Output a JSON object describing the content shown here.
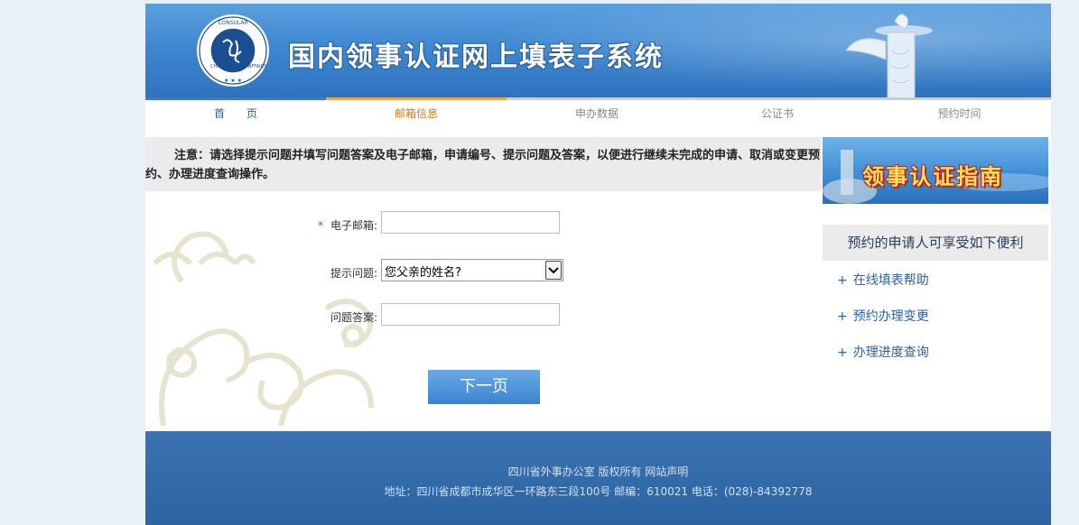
{
  "header": {
    "title": "国内领事认证网上填表子系统",
    "logo_text": "CHINA CONSULAR AFFAIRS 领事"
  },
  "steps": [
    {
      "label": "首　　页",
      "state": "done"
    },
    {
      "label": "邮箱信息",
      "state": "active"
    },
    {
      "label": "申办数据",
      "state": "pending"
    },
    {
      "label": "公证书",
      "state": "pending"
    },
    {
      "label": "预约时间",
      "state": "pending"
    }
  ],
  "notice": {
    "text": "注意：请选择提示问题并填写问题答案及电子邮箱，申请编号、提示问题及答案，以便进行继续未完成的申请、取消或变更预约、办理进度查询操作。"
  },
  "form": {
    "required_mark": "*",
    "email_label": "电子邮箱:",
    "email_value": "",
    "question_label": "提示问题:",
    "question_selected": "您父亲的姓名?",
    "answer_label": "问题答案:",
    "answer_value": "",
    "next_label": "下一页"
  },
  "sidebar": {
    "guide_banner": "领事认证指南",
    "benefit_title": "预约的申请人可享受如下便利",
    "links": [
      {
        "label": "在线填表帮助"
      },
      {
        "label": "预约办理变更"
      },
      {
        "label": "办理进度查询"
      }
    ],
    "plus": "+"
  },
  "footer": {
    "line1": "四川省外事办公室 版权所有 网站声明",
    "line2": "地址：四川省成都市成华区一环路东三段100号 邮编：610021 电话：(028)-84392778"
  },
  "colors": {
    "banner": "#3f88d1",
    "active_step": "#f0a64b",
    "done_step": "#3c7dbf",
    "footer": "#2d64a2",
    "button": "#3a84d0"
  }
}
